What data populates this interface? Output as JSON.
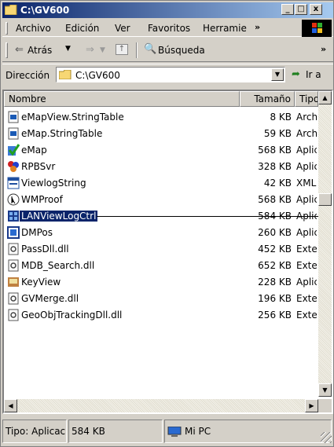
{
  "window": {
    "title": "C:\\GV600",
    "minimize": "_",
    "maximize": "□",
    "close": "x"
  },
  "menu": {
    "items": [
      "Archivo",
      "Edición",
      "Ver",
      "Favoritos",
      "Herramie"
    ],
    "overflow": "»"
  },
  "toolbar": {
    "back_label": "Atrás",
    "search_label": "Búsqueda",
    "overflow": "»"
  },
  "address": {
    "label": "Dirección",
    "value": "C:\\GV600",
    "go_label": "Ir a"
  },
  "list": {
    "columns": [
      "Nombre",
      "Tamaño",
      "Tipo"
    ],
    "rows": [
      {
        "name": "eMapView.StringTable",
        "size": "8 KB",
        "type": "Arch",
        "icon": "file-table-icon"
      },
      {
        "name": "eMap.StringTable",
        "size": "59 KB",
        "type": "Arch",
        "icon": "file-table-icon"
      },
      {
        "name": "eMap",
        "size": "568 KB",
        "type": "Aplic",
        "icon": "app-checkmark-icon"
      },
      {
        "name": "RPBSvr",
        "size": "328 KB",
        "type": "Aplic",
        "icon": "app-colorful-icon"
      },
      {
        "name": "ViewlogString",
        "size": "42 KB",
        "type": "XML",
        "icon": "xml-file-icon"
      },
      {
        "name": "WMProof",
        "size": "568 KB",
        "type": "Aplic",
        "icon": "app-cursor-icon"
      },
      {
        "name": "LANViewLogCtrl",
        "size": "584 KB",
        "type": "Aplic",
        "icon": "app-network-icon"
      },
      {
        "name": "DMPos",
        "size": "260 KB",
        "type": "Aplic",
        "icon": "app-window-icon"
      },
      {
        "name": "PassDll.dll",
        "size": "452 KB",
        "type": "Exte",
        "icon": "dll-file-icon"
      },
      {
        "name": "MDB_Search.dll",
        "size": "652 KB",
        "type": "Exte",
        "icon": "dll-file-icon"
      },
      {
        "name": "KeyView",
        "size": "228 KB",
        "type": "Aplic",
        "icon": "app-keyview-icon"
      },
      {
        "name": "GVMerge.dll",
        "size": "196 KB",
        "type": "Exte",
        "icon": "dll-file-icon"
      },
      {
        "name": "GeoObjTrackingDll.dll",
        "size": "256 KB",
        "type": "Exte",
        "icon": "dll-file-icon"
      }
    ]
  },
  "status": {
    "type_text": "Tipo: Aplicaci",
    "size_text": "584 KB",
    "location_text": "Mi PC"
  },
  "colors": {
    "title_start": "#0a246a",
    "title_end": "#a6caf0",
    "selection": "#0a246a",
    "face": "#d4d0c8"
  }
}
